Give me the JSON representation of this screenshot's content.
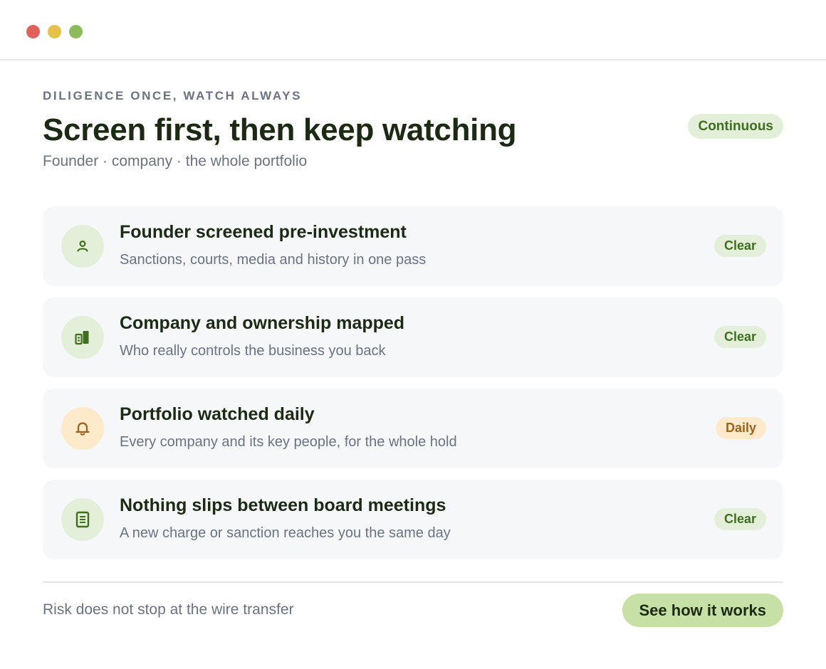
{
  "window": {
    "controls": [
      "close",
      "minimize",
      "zoom"
    ]
  },
  "header": {
    "eyebrow": "DILIGENCE ONCE, WATCH ALWAYS",
    "title": "Screen first, then keep watching",
    "subtitle": "Founder · company · the whole portfolio",
    "badge": "Continuous"
  },
  "items": [
    {
      "icon": "person-icon",
      "title": "Founder screened pre-investment",
      "description": "Sanctions, courts, media and history in one pass",
      "status": "Clear"
    },
    {
      "icon": "building-icon",
      "title": "Company and ownership mapped",
      "description": "Who really controls the business you back",
      "status": "Clear"
    },
    {
      "icon": "bell-icon",
      "title": "Portfolio watched daily",
      "description": "Every company and its key people, for the whole hold",
      "status": "Daily"
    },
    {
      "icon": "document-icon",
      "title": "Nothing slips between board meetings",
      "description": "A new charge or sanction reaches you the same day",
      "status": "Clear"
    }
  ],
  "footer": {
    "text": "Risk does not stop at the wire transfer",
    "cta_label": "See how it works"
  },
  "colors": {
    "accent_green": "#3f6e1f",
    "accent_green_bg": "#e4efd9",
    "accent_amber": "#a0621b",
    "accent_amber_bg": "#fdeacb",
    "cta_bg": "#c7e0a5",
    "heading": "#1c2a14",
    "muted": "#6b7280"
  }
}
